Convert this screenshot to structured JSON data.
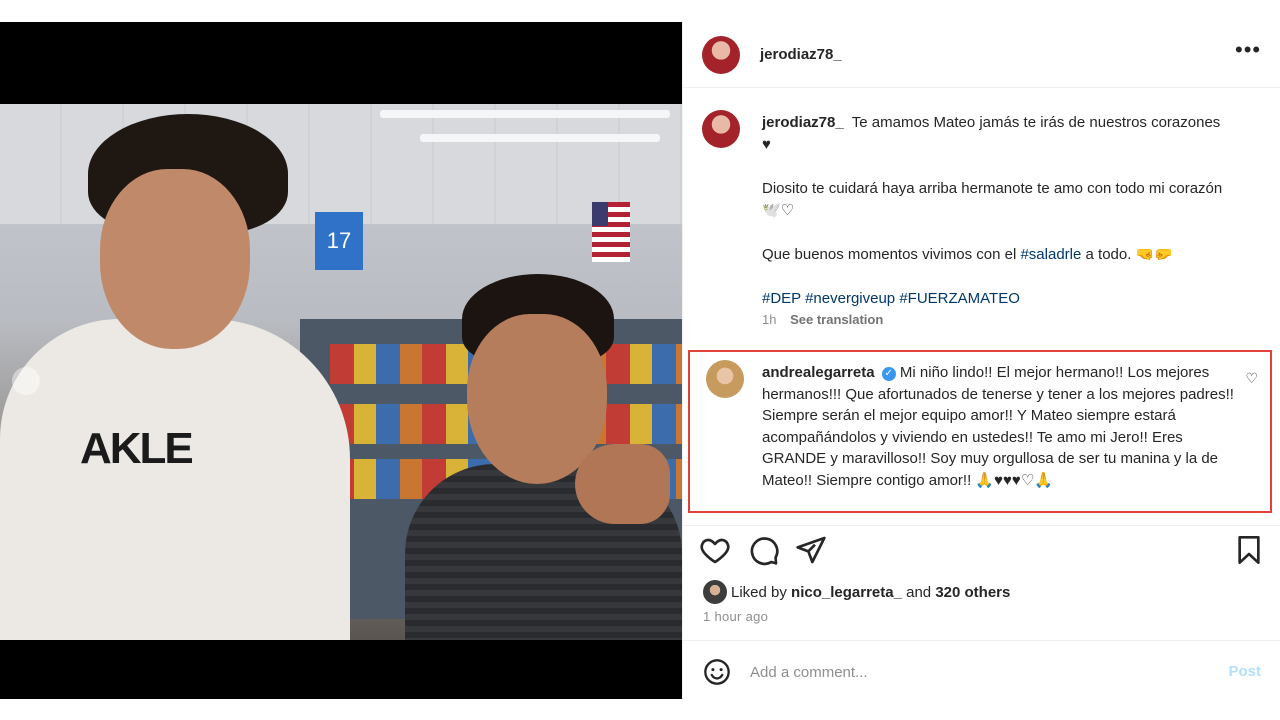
{
  "post": {
    "author": "jerodiaz78_",
    "caption": {
      "author": "jerodiaz78_",
      "line1": "Te amamos Mateo jamás te irás de nuestros corazones ♥",
      "line2": "Diosito te cuidará haya arriba hermanote te amo con todo mi corazón 🕊️♡",
      "line3_pre": "Que buenos momentos vivimos con el",
      "line3_tag": "#saladrle",
      "line3_post": "a todo. 🤜🤛",
      "hashtags": "#DEP #nevergiveup #FUERZAMATEO",
      "age": "1h",
      "see_translation": "See translation"
    },
    "comment": {
      "author": "andrealegarreta",
      "text": "Mi niño lindo!! El mejor hermano!! Los mejores hermanos!!! Que afortunados de tenerse y tener a los mejores padres!! Siempre serán el mejor equipo amor!! Y Mateo siempre estará acompañándolos y viviendo en ustedes!! Te amo mi Jero!! Eres GRANDE y maravilloso!! Soy muy orgullosa de ser tu manina y la de Mateo!! Siempre contigo amor!! 🙏♥♥♥♡🙏",
      "verified_icon": "verified-badge-icon"
    },
    "photo": {
      "aisle_number": "17",
      "shirt_text": "AKLE"
    },
    "likes": {
      "prefix": "Liked by",
      "user": "nico_legarreta_",
      "connector": "and",
      "others": "320 others"
    },
    "timestamp": "1 hour ago",
    "comment_box": {
      "placeholder": "Add a comment...",
      "post_label": "Post"
    }
  },
  "colors": {
    "link": "#00376b",
    "highlight_border": "#e0413a",
    "verified": "#3897f0",
    "post_disabled": "#b2dffc"
  }
}
